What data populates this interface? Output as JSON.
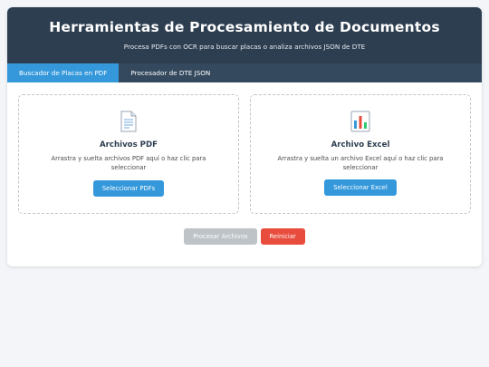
{
  "header": {
    "title": "Herramientas de Procesamiento de Documentos",
    "subtitle": "Procesa PDFs con OCR para buscar placas o analiza archivos JSON de DTE"
  },
  "tabs": [
    {
      "label": "Buscador de Placas en PDF",
      "active": true
    },
    {
      "label": "Procesador de DTE JSON",
      "active": false
    }
  ],
  "upload_zones": [
    {
      "icon": "document-icon",
      "title": "Archivos PDF",
      "description": "Arrastra y suelta archivos PDF aquí o haz clic para seleccionar",
      "button_label": "Seleccionar PDFs"
    },
    {
      "icon": "bar-chart-icon",
      "title": "Archivo Excel",
      "description": "Arrastra y suelta un archivo Excel aquí o haz clic para seleccionar",
      "button_label": "Seleccionar Excel"
    }
  ],
  "actions": {
    "process_label": "Procesar Archivos",
    "reset_label": "Reiniciar"
  },
  "colors": {
    "header_bg": "#2d3e50",
    "tab_bar_bg": "#34495e",
    "accent_blue": "#3498db",
    "disabled_gray": "#bdc3c7",
    "danger_red": "#e74c3c"
  }
}
